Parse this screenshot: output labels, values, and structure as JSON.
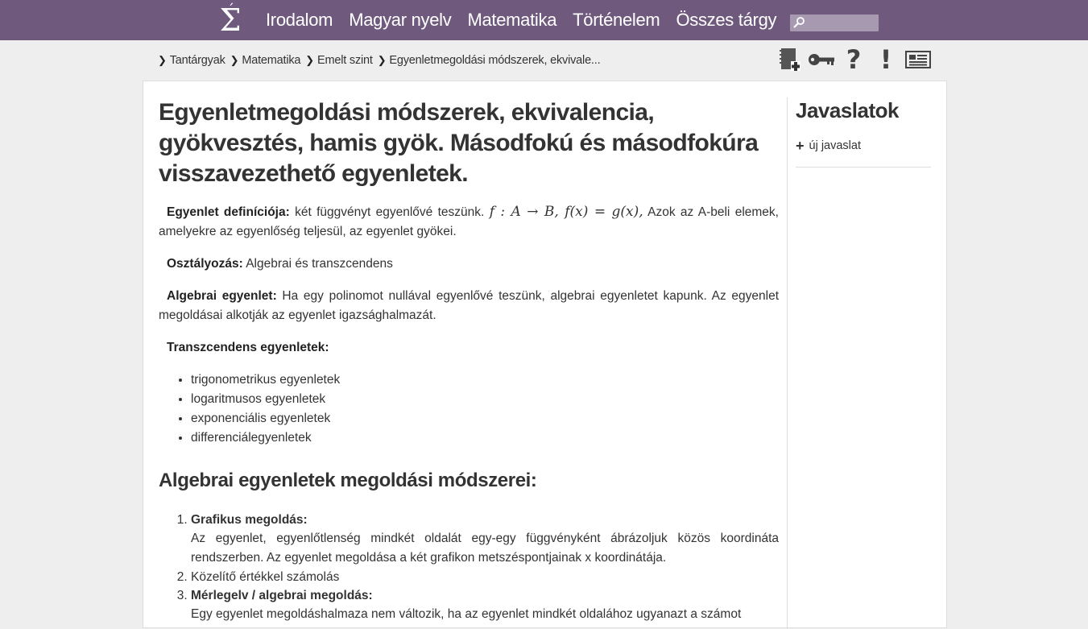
{
  "nav": {
    "logo": "Σ",
    "links": [
      "Irodalom",
      "Magyar nyelv",
      "Matematika",
      "Történelem",
      "Összes tárgy"
    ],
    "search_value": ""
  },
  "breadcrumb": [
    "Tantárgyak",
    "Matematika",
    "Emelt szint",
    "Egyenletmegoldási módszerek, ekvivale..."
  ],
  "tools": [
    "notebook-add-icon",
    "key-icon",
    "help-icon",
    "exclamation-icon",
    "news-icon"
  ],
  "article": {
    "title": "Egyenletmegoldási módszerek, ekvivalencia, gyökvesztés, hamis gyök. Másodfokú és másodfokúra visszavezethető egyenletek.",
    "definition_label": "Egyenlet definíciója:",
    "definition_text_a": " két függvényt egyenlővé teszünk. ",
    "definition_math": "f : A → B, f(x) = g(x),",
    "definition_text_b": " Azok az A-beli elemek, amelyekre az egyenlőség teljesül, az egyenlet gyökei.",
    "classification_label": "Osztályozás:",
    "classification_text": " Algebrai és transzcendens",
    "algebraic_label": "Algebrai egyenlet:",
    "algebraic_text": " Ha egy polinomot nullával egyenlővé teszünk, algebrai egyenletet kapunk. Az egyenlet megoldásai alkotják az egyenlet igazsághalmazát.",
    "transcendent_label": "Transzcendens egyenletek:",
    "transcendent_items": [
      "trigonometrikus egyenletek",
      "logaritmusos egyenletek",
      "exponenciális egyenletek",
      "differenciálegyenletek"
    ],
    "methods_heading": "Algebrai egyenletek megoldási módszerei:",
    "methods": [
      {
        "title": "Grafikus megoldás:",
        "desc": "Az egyenlet, egyenlőtlenség mindkét oldalát egy-egy függvényként ábrázoljuk közös koordináta rendszerben. Az egyenlet megoldása a két grafikon metszéspontjainak x koordinátája."
      },
      {
        "title": "Közelítő értékkel számolás",
        "desc": ""
      },
      {
        "title": "Mérlegelv / algebrai megoldás:",
        "desc": "Egy egyenlet megoldáshalmaza nem változik, ha az egyenlet mindkét oldalához ugyanazt a számot"
      }
    ]
  },
  "sidebar": {
    "heading": "Javaslatok",
    "add_label": "új javaslat"
  }
}
